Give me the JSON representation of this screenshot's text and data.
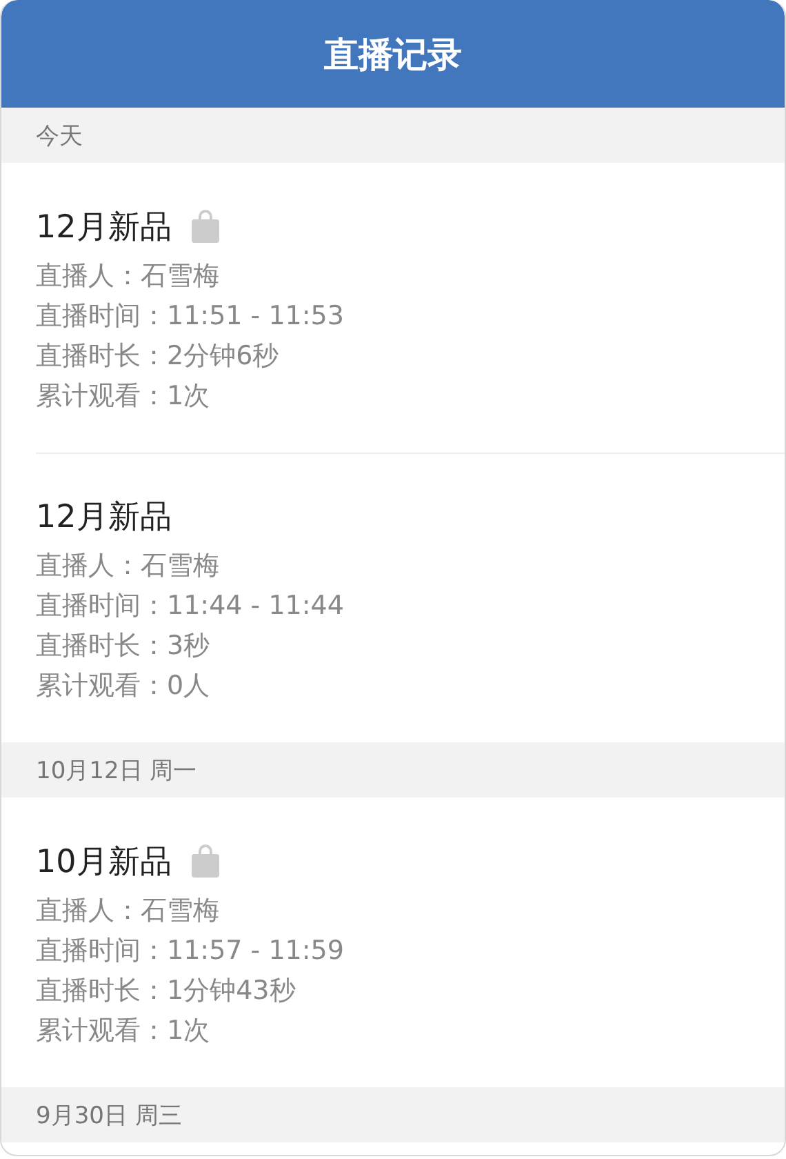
{
  "header": {
    "title": "直播记录"
  },
  "sections": [
    {
      "date": "今天",
      "records": [
        {
          "title": "12月新品",
          "product_tag": true,
          "lines": [
            "直播人：石雪梅",
            "直播时间：11:51 - 11:53",
            "直播时长：2分钟6秒",
            "累计观看：1次"
          ]
        },
        {
          "title": "12月新品",
          "product_tag": false,
          "lines": [
            "直播人：石雪梅",
            "直播时间：11:44 - 11:44",
            "直播时长：3秒",
            "累计观看：0人"
          ]
        }
      ]
    },
    {
      "date": "10月12日 周一",
      "records": [
        {
          "title": "10月新品",
          "product_tag": true,
          "lines": [
            "直播人：石雪梅",
            "直播时间：11:57 - 11:59",
            "直播时长：1分钟43秒",
            "累计观看：1次"
          ]
        }
      ]
    },
    {
      "date": "9月30日 周三"
    }
  ]
}
